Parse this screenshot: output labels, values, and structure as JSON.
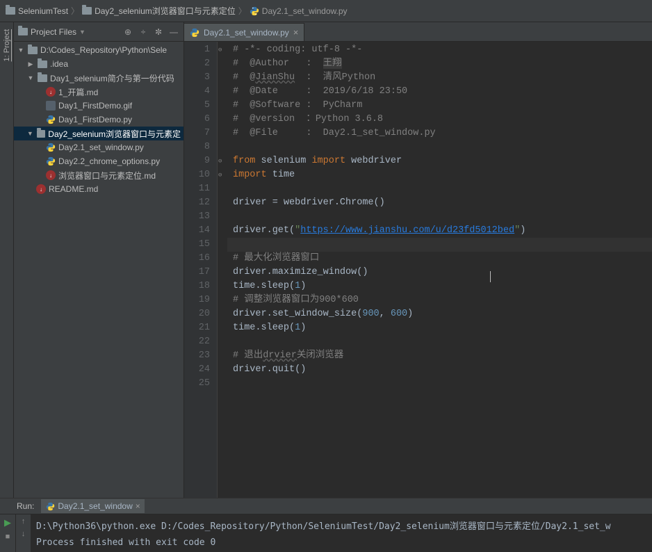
{
  "breadcrumb": {
    "seg0": "SeleniumTest",
    "seg1": "Day2_selenium浏览器窗口与元素定位",
    "seg2": "Day2.1_set_window.py"
  },
  "side_tab": "1: Project",
  "panel_title": "Project Files",
  "tree": {
    "root": "D:\\Codes_Repository\\Python\\Sele",
    "idea": ".idea",
    "day1": "Day1_selenium简介与第一份代码",
    "day1_a": "1_开篇.md",
    "day1_b": "Day1_FirstDemo.gif",
    "day1_c": "Day1_FirstDemo.py",
    "day2": "Day2_selenium浏览器窗口与元素定",
    "day2_a": "Day2.1_set_window.py",
    "day2_b": "Day2.2_chrome_options.py",
    "day2_c": "浏览器窗口与元素定位.md",
    "readme": "README.md"
  },
  "tab": {
    "name": "Day2.1_set_window.py"
  },
  "code": {
    "l1": "# -*- coding: utf-8 -*-",
    "l2a": "#  @Author   :  ",
    "l2b": "王翔",
    "l3a": "#  @",
    "l3b": "JianShu",
    "l3c": "  :  清风Python",
    "l4": "#  @Date     :  2019/6/18 23:50",
    "l5": "#  @Software :  PyCharm",
    "l6": "#  @version  ：Python 3.6.8",
    "l7": "#  @File     :  Day2.1_set_window.py",
    "l9a": "from",
    "l9b": "selenium",
    "l9c": "import",
    "l9d": "webdriver",
    "l10a": "import",
    "l10b": "time",
    "l12": "driver = webdriver.Chrome()",
    "l14a": "driver.get(",
    "l14b": "\"",
    "l14c": "https://www.jianshu.com/u/d23fd5012bed",
    "l14d": "\"",
    "l14e": ")",
    "l16": "# 最大化浏览器窗口",
    "l17": "driver.maximize_window()",
    "l18a": "time.sleep(",
    "l18b": "1",
    "l18c": ")",
    "l19": "# 调整浏览器窗口为900*600",
    "l20a": "driver.set_window_size(",
    "l20b": "900",
    "l20c": ", ",
    "l20d": "600",
    "l20e": ")",
    "l21a": "time.sleep(",
    "l21b": "1",
    "l21c": ")",
    "l23a": "# 退出",
    "l23b": "drvier",
    "l23c": "关闭浏览器",
    "l24": "driver.quit()"
  },
  "line_count": 25,
  "run": {
    "label": "Run:",
    "config": "Day2.1_set_window",
    "out1": "D:\\Python36\\python.exe D:/Codes_Repository/Python/SeleniumTest/Day2_selenium浏览器窗口与元素定位/Day2.1_set_w",
    "out2": "Process finished with exit code 0"
  }
}
